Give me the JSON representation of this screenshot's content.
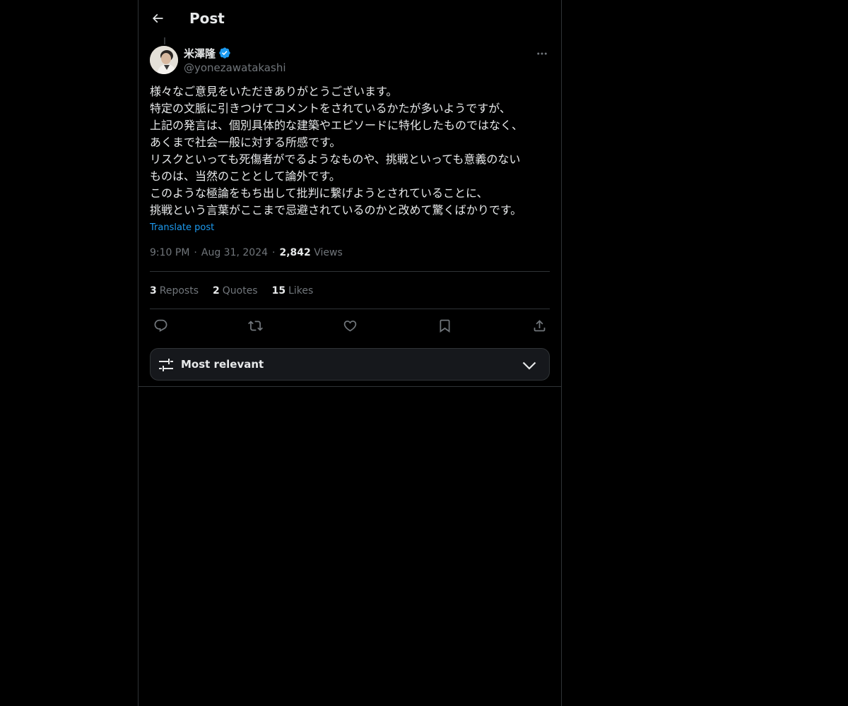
{
  "header": {
    "title": "Post",
    "back_icon": "arrow-left-icon"
  },
  "author": {
    "display_name": "米澤隆",
    "handle": "@yonezawatakashi",
    "verified": true,
    "verified_color": "#1d9bf0"
  },
  "post": {
    "lines": [
      "様々なご意見をいただきありがとうございます。",
      "特定の文脈に引きつけてコメントをされているかたが多いようですが、",
      "上記の発言は、個別具体的な建築やエピソードに特化したものではなく、",
      "あくまで社会一般に対する所感です。",
      "リスクといっても死傷者がでるようなものや、挑戦といっても意義のない",
      "ものは、当然のこととして論外です。",
      "このような極論をもち出して批判に繋げようとされていることに、",
      "挑戦という言葉がここまで忌避されているのかと改めて驚くばかりです。"
    ],
    "translate_label": "Translate post"
  },
  "meta": {
    "time": "9:10 PM",
    "separator": "·",
    "date": "Aug 31, 2024",
    "views_count": "2,842",
    "views_label": "Views"
  },
  "stats": {
    "reposts_count": "3",
    "reposts_label": "Reposts",
    "quotes_count": "2",
    "quotes_label": "Quotes",
    "likes_count": "15",
    "likes_label": "Likes"
  },
  "actions": [
    "reply-icon",
    "repost-icon",
    "like-icon",
    "bookmark-icon",
    "share-icon"
  ],
  "sort": {
    "label": "Most relevant",
    "icon": "sliders-icon",
    "chevron": "chevron-down-icon"
  },
  "colors": {
    "background": "#000000",
    "text": "#e7e9ea",
    "muted": "#71767b",
    "link": "#1d9bf0",
    "border": "#2f3336"
  }
}
